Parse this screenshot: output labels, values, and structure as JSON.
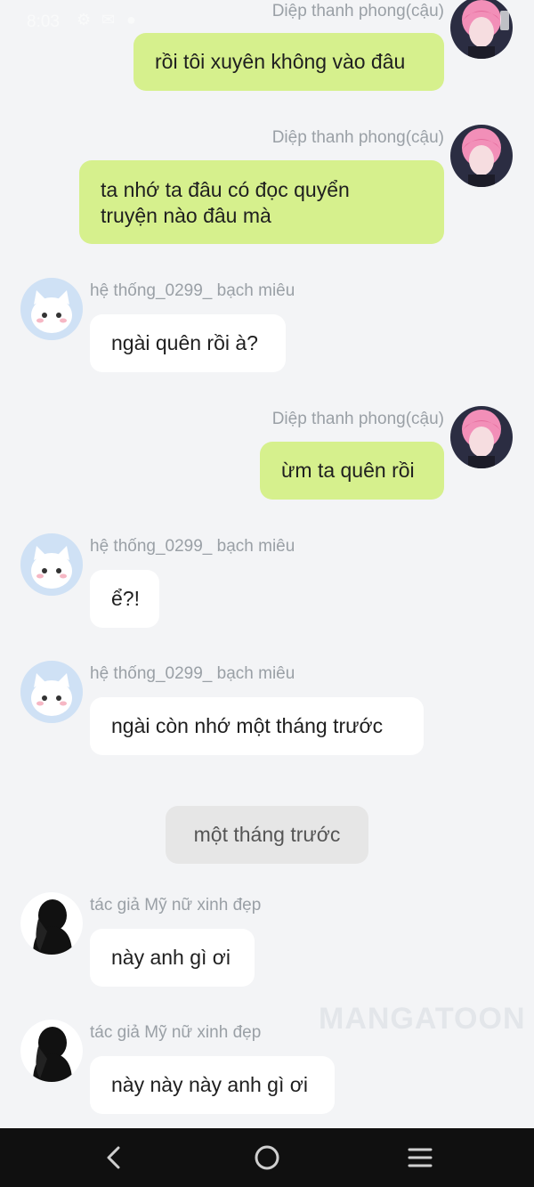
{
  "status_bar": {
    "time": "8:03"
  },
  "messages": [
    {
      "side": "right",
      "sender": "Diệp thanh phong(cậu)",
      "avatar": "pink-hair-boy-avatar",
      "text": "rồi tôi xuyên không vào đâu"
    },
    {
      "side": "right",
      "sender": "Diệp thanh phong(cậu)",
      "avatar": "pink-hair-boy-avatar",
      "lines": [
        "ta nhớ ta đâu có đọc quyển",
        "truyện nào đâu mà"
      ]
    },
    {
      "side": "left",
      "sender": "hệ thống_0299_ bạch miêu",
      "avatar": "white-cat-avatar",
      "text": "ngài quên rồi à?"
    },
    {
      "side": "right",
      "sender": "Diệp thanh phong(cậu)",
      "avatar": "pink-hair-boy-avatar",
      "text": "ừm ta quên rồi"
    },
    {
      "side": "left",
      "sender": "hệ thống_0299_ bạch miêu",
      "avatar": "white-cat-avatar",
      "text": "ể?!"
    },
    {
      "side": "left",
      "sender": "hệ thống_0299_ bạch miêu",
      "avatar": "white-cat-avatar",
      "text": "ngài còn nhớ một tháng trước"
    },
    {
      "side": "left",
      "sender": "tác giả Mỹ nữ xinh đẹp",
      "avatar": "dark-silhouette-avatar",
      "text": "này anh gì ơi"
    },
    {
      "side": "left",
      "sender": "tác giả Mỹ nữ xinh đẹp",
      "avatar": "dark-silhouette-avatar",
      "text": "này này này anh gì ơi"
    }
  ],
  "divider": {
    "text": "một tháng trước"
  },
  "watermark": {
    "text": "MANGATOON"
  },
  "nav_bar": {
    "icons": [
      "back-chevron-icon",
      "home-circle-icon",
      "menu-lines-icon"
    ]
  },
  "colors": {
    "outgoing_bubble": "#d6f08d",
    "incoming_bubble": "#ffffff",
    "background": "#f3f4f6",
    "divider": "#e6e6e6",
    "nav": "#101010"
  }
}
